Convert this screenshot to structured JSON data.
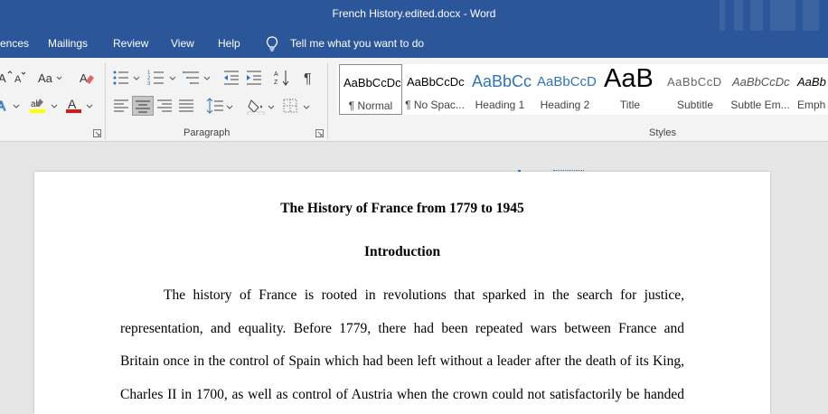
{
  "window": {
    "title": "French History.edited.docx  -  Word"
  },
  "ribbon_tabs": {
    "references": "ences",
    "mailings": "Mailings",
    "review": "Review",
    "view": "View",
    "help": "Help",
    "tell_me": "Tell me what you want to do"
  },
  "groups": {
    "paragraph": "Paragraph",
    "styles": "Styles"
  },
  "styles_gallery": [
    {
      "preview": "AaBbCcDc",
      "name": "¶ Normal"
    },
    {
      "preview": "AaBbCcDc",
      "name": "¶ No Spac..."
    },
    {
      "preview": "AaBbCc",
      "name": "Heading 1"
    },
    {
      "preview": "AaBbCcD",
      "name": "Heading 2"
    },
    {
      "preview": "AaB",
      "name": "Title"
    },
    {
      "preview": "AaBbCcD",
      "name": "Subtitle"
    },
    {
      "preview": "AaBbCcDc",
      "name": "Subtle Em..."
    },
    {
      "preview": "AaBb",
      "name": "Emph"
    }
  ],
  "colors": {
    "accent": "#2b579a",
    "highlight": "#ffff00",
    "font_color": "#d11a1a",
    "heading_blue": "#2e74b5"
  },
  "document": {
    "title": "The History of France from 1779 to 1945",
    "heading": "Introduction",
    "paragraph_lines": [
      "The history of France is rooted in revolutions that sparked in the search for justice,",
      "representation, and equality. Before 1779, there had been repeated wars between France and",
      "Britain once in the control of Spain which had been left without a leader after the death of its King,",
      "Charles II in 1700, as well as control of Austria when the crown could not satisfactorily be handed"
    ]
  }
}
